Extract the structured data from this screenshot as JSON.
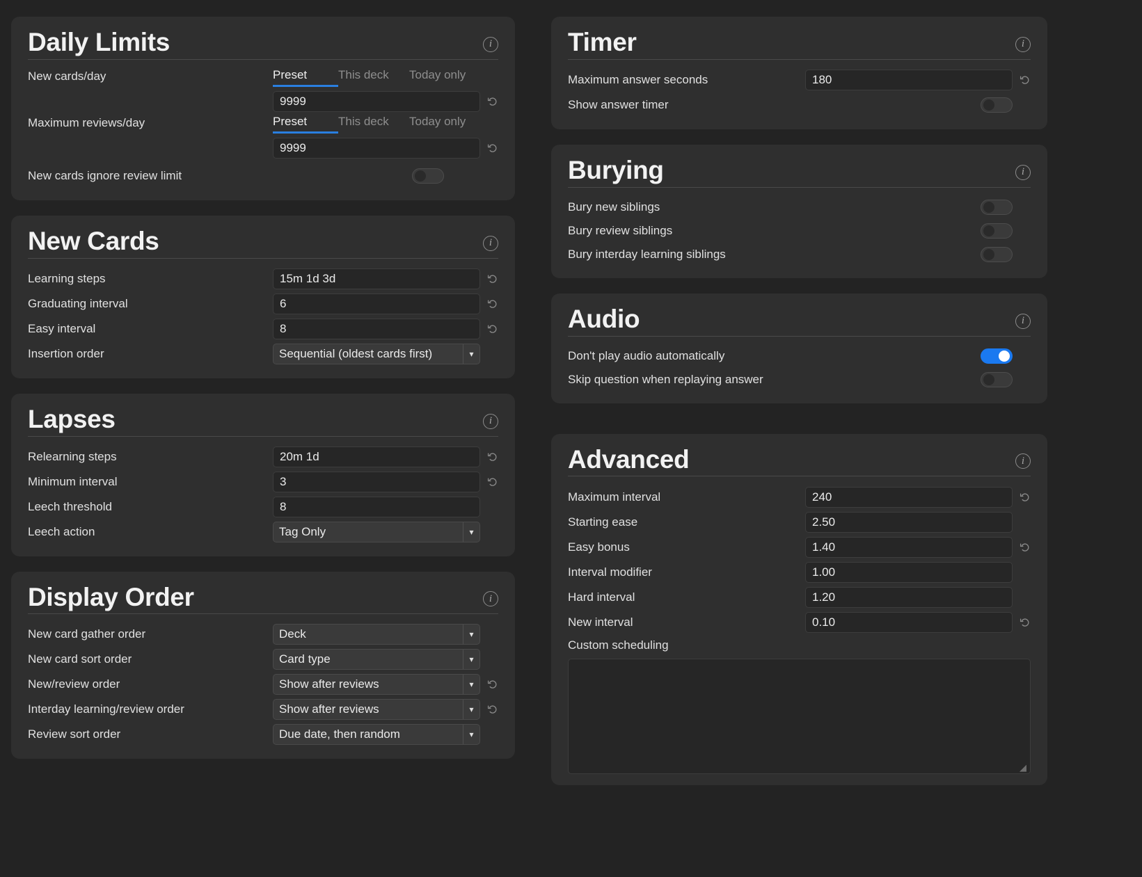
{
  "accent_color": "#1a79f0",
  "tab_underline_color": "#2a7fe0",
  "icons": {
    "info": "info-icon",
    "reset": "reset-revert-icon",
    "chevron_down": "chevron-down-icon",
    "resize_grip": "resize-grip-icon"
  },
  "sections": {
    "daily_limits": {
      "title": "Daily Limits",
      "new_cards_per_day": {
        "label": "New cards/day",
        "tabs": [
          "Preset",
          "This deck",
          "Today only"
        ],
        "active_tab": "Preset",
        "value": "9999"
      },
      "maximum_reviews_per_day": {
        "label": "Maximum reviews/day",
        "tabs": [
          "Preset",
          "This deck",
          "Today only"
        ],
        "active_tab": "Preset",
        "value": "9999"
      },
      "new_cards_ignore_review_limit": {
        "label": "New cards ignore review limit",
        "state": "off"
      }
    },
    "new_cards": {
      "title": "New Cards",
      "rows": [
        {
          "label": "Learning steps",
          "value": "15m 1d 3d",
          "type": "text",
          "reset": true
        },
        {
          "label": "Graduating interval",
          "value": "6",
          "type": "text",
          "reset": true
        },
        {
          "label": "Easy interval",
          "value": "8",
          "type": "text",
          "reset": true
        },
        {
          "label": "Insertion order",
          "value": "Sequential (oldest cards first)",
          "type": "select",
          "reset": false
        }
      ]
    },
    "lapses": {
      "title": "Lapses",
      "rows": [
        {
          "label": "Relearning steps",
          "value": "20m 1d",
          "type": "text",
          "reset": true
        },
        {
          "label": "Minimum interval",
          "value": "3",
          "type": "text",
          "reset": true
        },
        {
          "label": "Leech threshold",
          "value": "8",
          "type": "text",
          "reset": false
        },
        {
          "label": "Leech action",
          "value": "Tag Only",
          "type": "select",
          "reset": false
        }
      ]
    },
    "display_order": {
      "title": "Display Order",
      "rows": [
        {
          "label": "New card gather order",
          "value": "Deck",
          "type": "select",
          "reset": false
        },
        {
          "label": "New card sort order",
          "value": "Card type",
          "type": "select",
          "reset": false
        },
        {
          "label": "New/review order",
          "value": "Show after reviews",
          "type": "select",
          "reset": true
        },
        {
          "label": "Interday learning/review order",
          "value": "Show after reviews",
          "type": "select",
          "reset": true
        },
        {
          "label": "Review sort order",
          "value": "Due date, then random",
          "type": "select",
          "reset": false
        }
      ]
    },
    "timer": {
      "title": "Timer",
      "maximum_answer_seconds": {
        "label": "Maximum answer seconds",
        "value": "180",
        "reset": true
      },
      "show_answer_timer": {
        "label": "Show answer timer",
        "state": "off"
      }
    },
    "burying": {
      "title": "Burying",
      "toggles": [
        {
          "label": "Bury new siblings",
          "state": "off"
        },
        {
          "label": "Bury review siblings",
          "state": "off"
        },
        {
          "label": "Bury interday learning siblings",
          "state": "off"
        }
      ]
    },
    "audio": {
      "title": "Audio",
      "toggles": [
        {
          "label": "Don't play audio automatically",
          "state": "on"
        },
        {
          "label": "Skip question when replaying answer",
          "state": "off"
        }
      ]
    },
    "advanced": {
      "title": "Advanced",
      "rows": [
        {
          "label": "Maximum interval",
          "value": "240",
          "reset": true
        },
        {
          "label": "Starting ease",
          "value": "2.50",
          "reset": false
        },
        {
          "label": "Easy bonus",
          "value": "1.40",
          "reset": true
        },
        {
          "label": "Interval modifier",
          "value": "1.00",
          "reset": false
        },
        {
          "label": "Hard interval",
          "value": "1.20",
          "reset": false
        },
        {
          "label": "New interval",
          "value": "0.10",
          "reset": true
        }
      ],
      "custom_scheduling": {
        "label": "Custom scheduling",
        "value": ""
      }
    }
  }
}
